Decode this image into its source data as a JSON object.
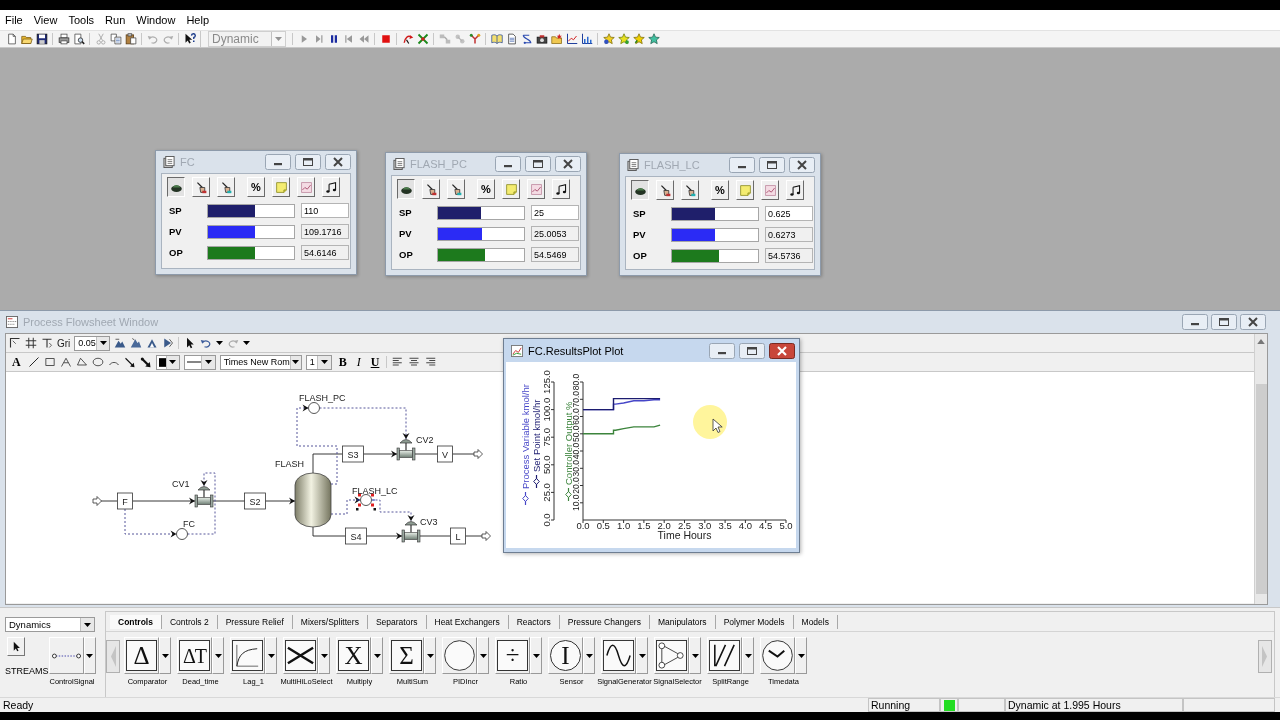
{
  "menu": [
    "File",
    "View",
    "Tools",
    "Run",
    "Window",
    "Help"
  ],
  "toolbar": [
    [
      {
        "kind": "new",
        "disabled": false
      },
      {
        "kind": "open",
        "disabled": false
      },
      {
        "kind": "save",
        "disabled": false
      }
    ],
    [
      {
        "kind": "print",
        "disabled": false
      },
      {
        "kind": "preview",
        "disabled": false
      }
    ],
    [
      {
        "kind": "cut",
        "disabled": true
      },
      {
        "kind": "copy",
        "disabled": false
      },
      {
        "kind": "paste",
        "disabled": false
      }
    ],
    [
      {
        "kind": "undo",
        "disabled": true
      },
      {
        "kind": "redo",
        "disabled": true
      }
    ],
    [
      {
        "kind": "help",
        "disabled": false
      }
    ],
    [
      {
        "kind": "combo",
        "value": "Dynamic",
        "disabled": true
      }
    ],
    [
      {
        "kind": "run",
        "disabled": true
      },
      {
        "kind": "step",
        "disabled": true
      },
      {
        "kind": "pause",
        "disabled": false
      },
      {
        "kind": "restart",
        "disabled": true
      },
      {
        "kind": "rewind",
        "disabled": true
      }
    ],
    [
      {
        "kind": "stop",
        "disabled": false
      }
    ],
    [
      {
        "kind": "arrows",
        "disabled": false
      },
      {
        "kind": "crossed",
        "disabled": false
      }
    ],
    [
      {
        "kind": "linkbox",
        "disabled": true
      },
      {
        "kind": "linkball",
        "disabled": true
      },
      {
        "kind": "tree",
        "disabled": false
      }
    ],
    [
      {
        "kind": "book",
        "disabled": false
      },
      {
        "kind": "document",
        "disabled": false
      },
      {
        "kind": "curve",
        "disabled": false
      },
      {
        "kind": "camera",
        "disabled": false
      },
      {
        "kind": "folderstar",
        "disabled": false
      },
      {
        "kind": "linechart",
        "disabled": false
      },
      {
        "kind": "barchart",
        "disabled": false
      }
    ],
    [
      {
        "kind": "stargear",
        "disabled": false
      },
      {
        "kind": "star",
        "disabled": false
      },
      {
        "kind": "starpair",
        "disabled": false
      },
      {
        "kind": "starteal",
        "disabled": false
      }
    ]
  ],
  "faceplates": [
    {
      "title": "FC",
      "active": false,
      "buttons": [
        {
          "kind": "auto",
          "pressed": true
        },
        {
          "kind": "manual",
          "pressed": false
        },
        {
          "kind": "cascade",
          "pressed": false
        },
        {
          "kind": "percent",
          "label": "%",
          "pressed": false
        },
        {
          "kind": "note",
          "pressed": false
        },
        {
          "kind": "plot",
          "pressed": false
        },
        {
          "kind": "tune",
          "pressed": false
        }
      ],
      "rows": [
        {
          "label": "SP",
          "level": 0.545,
          "color": "#1f1f6b",
          "value": "110",
          "editable": true
        },
        {
          "label": "PV",
          "level": 0.545,
          "color": "#2b2bf5",
          "value": "109.1716",
          "editable": false
        },
        {
          "label": "OP",
          "level": 0.545,
          "color": "#1d7a1d",
          "value": "54.6146",
          "editable": false
        }
      ]
    },
    {
      "title": "FLASH_PC",
      "active": false,
      "buttons": [
        {
          "kind": "auto",
          "pressed": true
        },
        {
          "kind": "manual",
          "pressed": false
        },
        {
          "kind": "cascade",
          "pressed": false
        },
        {
          "kind": "percent",
          "label": "%",
          "pressed": false
        },
        {
          "kind": "note",
          "pressed": false
        },
        {
          "kind": "plot",
          "pressed": false
        },
        {
          "kind": "tune",
          "pressed": false
        }
      ],
      "rows": [
        {
          "label": "SP",
          "level": 0.5,
          "color": "#1f1f6b",
          "value": "25",
          "editable": true
        },
        {
          "label": "PV",
          "level": 0.51,
          "color": "#2b2bf5",
          "value": "25.0053",
          "editable": false
        },
        {
          "label": "OP",
          "level": 0.55,
          "color": "#1d7a1d",
          "value": "54.5469",
          "editable": false
        }
      ]
    },
    {
      "title": "FLASH_LC",
      "active": false,
      "buttons": [
        {
          "kind": "auto",
          "pressed": true
        },
        {
          "kind": "manual",
          "pressed": false
        },
        {
          "kind": "cascade",
          "pressed": false
        },
        {
          "kind": "percent",
          "label": "%",
          "pressed": false
        },
        {
          "kind": "note",
          "pressed": false
        },
        {
          "kind": "plot",
          "pressed": false
        },
        {
          "kind": "tune",
          "pressed": false
        }
      ],
      "rows": [
        {
          "label": "SP",
          "level": 0.495,
          "color": "#1f1f6b",
          "value": "0.625",
          "editable": true
        },
        {
          "label": "PV",
          "level": 0.505,
          "color": "#2b2bf5",
          "value": "0.6273",
          "editable": false
        },
        {
          "label": "OP",
          "level": 0.545,
          "color": "#1d7a1d",
          "value": "54.5736",
          "editable": false
        }
      ]
    }
  ],
  "flowsheet": {
    "title": "Process Flowsheet Window",
    "active": false,
    "toolbar_rows": [
      [
        [
          {
            "kind": "corner",
            "disabled": false
          },
          {
            "kind": "grid",
            "disabled": false
          },
          {
            "kind": "snap",
            "disabled": false
          },
          {
            "kind": "label",
            "label": "Gri",
            "disabled": false
          },
          {
            "kind": "combo",
            "value": "0.05",
            "disabled": false
          },
          {
            "kind": "mount1",
            "disabled": false
          },
          {
            "kind": "mount2",
            "disabled": false
          },
          {
            "kind": "mount3",
            "disabled": false
          },
          {
            "kind": "mount4",
            "disabled": false
          }
        ],
        [
          {
            "kind": "pointer",
            "disabled": false
          },
          {
            "kind": "undodrop",
            "disabled": false
          },
          {
            "kind": "redodrop",
            "disabled": true
          }
        ]
      ],
      [
        [
          {
            "kind": "text",
            "label": "A",
            "disabled": false
          },
          {
            "kind": "line",
            "disabled": false
          },
          {
            "kind": "rect",
            "disabled": false
          },
          {
            "kind": "polyline",
            "disabled": false
          },
          {
            "kind": "polygon",
            "disabled": false
          },
          {
            "kind": "ellipse",
            "disabled": false
          },
          {
            "kind": "arc",
            "disabled": false
          },
          {
            "kind": "arrow",
            "disabled": false
          },
          {
            "kind": "thickarrow",
            "disabled": false
          },
          {
            "kind": "color",
            "color": "#000000",
            "disabled": false
          },
          {
            "kind": "linestyle",
            "disabled": false
          },
          {
            "kind": "font",
            "value": "Times New Rom",
            "disabled": false
          },
          {
            "kind": "size",
            "value": "1",
            "disabled": false
          },
          {
            "kind": "bold",
            "label": "B",
            "disabled": false
          },
          {
            "kind": "italic",
            "label": "I",
            "disabled": false
          },
          {
            "kind": "underline",
            "label": "U",
            "disabled": false
          }
        ],
        [
          {
            "kind": "alignleft",
            "disabled": false
          },
          {
            "kind": "aligncenter",
            "disabled": false
          },
          {
            "kind": "alignright",
            "disabled": false
          }
        ]
      ]
    ],
    "blocks": [
      {
        "label": "FLASH_PC",
        "kind": "controller",
        "selected": false
      },
      {
        "label": "CV2",
        "kind": "valve",
        "selected": false
      },
      {
        "label": "FLASH",
        "kind": "vessel",
        "selected": false
      },
      {
        "label": "CV1",
        "kind": "valve",
        "selected": false
      },
      {
        "label": "FLASH_LC",
        "kind": "controller",
        "selected": true
      },
      {
        "label": "FC",
        "kind": "controller",
        "selected": false
      },
      {
        "label": "CV3",
        "kind": "valve",
        "selected": false
      }
    ],
    "streams": [
      {
        "label": "S3"
      },
      {
        "label": "V"
      },
      {
        "label": "F"
      },
      {
        "label": "S2"
      },
      {
        "label": "S4"
      },
      {
        "label": "L"
      }
    ]
  },
  "plot": {
    "title": "FC.ResultsPlot Plot",
    "active": true,
    "chart_data": {
      "type": "line",
      "xlabel": "Time Hours",
      "x": [
        0,
        0.75,
        0.75,
        0.8,
        1.0,
        1.25,
        1.5,
        1.75,
        1.9
      ],
      "series": [
        {
          "name": "Process Variable kmol/hr",
          "color": "#4646c8",
          "values": [
            100,
            100,
            105,
            105,
            106,
            108,
            108,
            109,
            109
          ]
        },
        {
          "name": "Set Point kmol/hr",
          "color": "#1c1c70",
          "values": [
            100,
            100,
            110,
            110,
            110,
            110,
            110,
            110,
            110
          ]
        },
        {
          "name": "Controller Output %",
          "color": "#3c843c",
          "axis": "y2",
          "values": [
            50,
            50,
            52,
            52,
            53,
            54,
            54,
            54,
            55
          ]
        }
      ],
      "xlim": [
        0,
        5
      ],
      "ylim": [
        0,
        125
      ],
      "y2lim": [
        0,
        80
      ],
      "xticks": [
        {
          "value": 0,
          "label": "0.0"
        },
        {
          "value": 0.5,
          "label": "0.5"
        },
        {
          "value": 1,
          "label": "1.0"
        },
        {
          "value": 1.5,
          "label": "1.5"
        },
        {
          "value": 2,
          "label": "2.0"
        },
        {
          "value": 2.5,
          "label": "2.5"
        },
        {
          "value": 3,
          "label": "3.0"
        },
        {
          "value": 3.5,
          "label": "3.5"
        },
        {
          "value": 4,
          "label": "4.0"
        },
        {
          "value": 4.5,
          "label": "4.5"
        },
        {
          "value": 5,
          "label": "5.0"
        }
      ],
      "yticks": [
        {
          "value": 0,
          "label": "0.0"
        },
        {
          "value": 25,
          "label": "25.0"
        },
        {
          "value": 50,
          "label": "50.0"
        },
        {
          "value": 75,
          "label": "75.0"
        },
        {
          "value": 100,
          "label": "100.0"
        },
        {
          "value": 125,
          "label": "125.0"
        }
      ],
      "y2ticks": [
        {
          "value": 10,
          "label": "10.0"
        },
        {
          "value": 20,
          "label": "20.0"
        },
        {
          "value": 30,
          "label": "30.0"
        },
        {
          "value": 40,
          "label": "40.0"
        },
        {
          "value": 50,
          "label": "50.0"
        },
        {
          "value": 60,
          "label": "60.0"
        },
        {
          "value": 70,
          "label": "70.0"
        },
        {
          "value": 80,
          "label": "80.0"
        }
      ]
    }
  },
  "palette": {
    "library": "Dynamics",
    "streams_label": "STREAMS",
    "stream_tool": "ControlSignal",
    "tabs": [
      {
        "label": "Controls",
        "selected": true
      },
      {
        "label": "Controls 2",
        "selected": false
      },
      {
        "label": "Pressure Relief",
        "selected": false
      },
      {
        "label": "Mixers/Splitters",
        "selected": false
      },
      {
        "label": "Separators",
        "selected": false
      },
      {
        "label": "Heat Exchangers",
        "selected": false
      },
      {
        "label": "Reactors",
        "selected": false
      },
      {
        "label": "Pressure Changers",
        "selected": false
      },
      {
        "label": "Manipulators",
        "selected": false
      },
      {
        "label": "Polymer Models",
        "selected": false
      },
      {
        "label": "Models",
        "selected": false
      }
    ],
    "models": [
      {
        "label": "Comparator",
        "kind": "glyph",
        "glyph": "Δ"
      },
      {
        "label": "Dead_time",
        "kind": "glyph",
        "glyph": "ΔT"
      },
      {
        "label": "Lag_1",
        "kind": "lag"
      },
      {
        "label": "MultiHiLoSelect",
        "kind": "bowtie"
      },
      {
        "label": "Multiply",
        "kind": "glyph",
        "glyph": "X"
      },
      {
        "label": "MultiSum",
        "kind": "glyph",
        "glyph": "Σ"
      },
      {
        "label": "PIDIncr",
        "kind": "circle"
      },
      {
        "label": "Ratio",
        "kind": "glyph",
        "glyph": "÷"
      },
      {
        "label": "Sensor",
        "kind": "ring",
        "glyph": "I"
      },
      {
        "label": "SignalGenerator",
        "kind": "sine"
      },
      {
        "label": "SignalSelector",
        "kind": "selector"
      },
      {
        "label": "SplitRange",
        "kind": "slashes"
      },
      {
        "label": "Timedata",
        "kind": "clock"
      }
    ]
  },
  "status_bar": {
    "message": "Ready",
    "state": "Running",
    "indicator_on": true,
    "time": "Dynamic at 1.995 Hours"
  }
}
